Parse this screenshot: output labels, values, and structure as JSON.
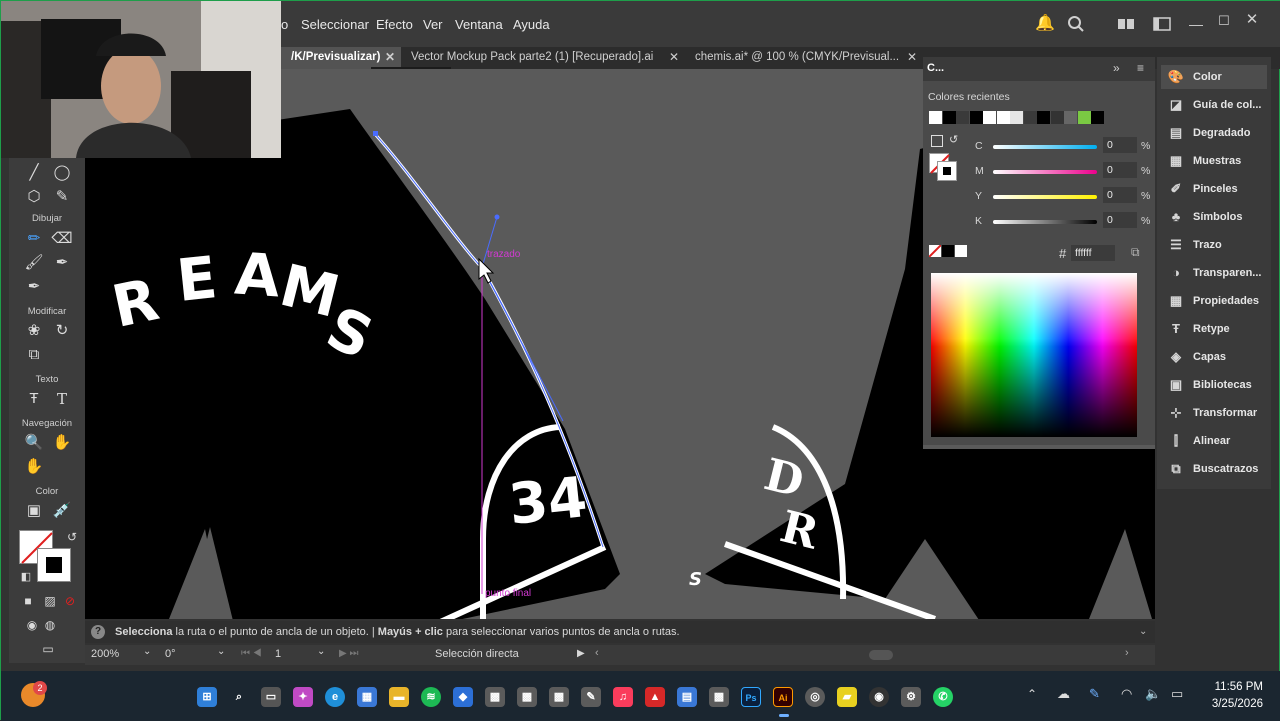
{
  "menu": {
    "items": [
      "o",
      "Seleccionar",
      "Efecto",
      "Ver",
      "Ventana",
      "Ayuda"
    ]
  },
  "tabs": [
    {
      "label": "/K/Previsualizar)",
      "active": true
    },
    {
      "label": "Vector Mockup Pack parte2  (1) [Recuperado].ai",
      "active": false
    },
    {
      "label": "chemis.ai* @ 100 % (CMYK/Previsual...",
      "active": false
    }
  ],
  "tools": {
    "group_draw": "Dibujar",
    "group_modify": "Modificar",
    "group_text": "Texto",
    "group_nav": "Navegación",
    "group_color": "Color"
  },
  "artwork": {
    "letters": [
      "R",
      "E",
      "A",
      "M",
      "S"
    ],
    "number": "34",
    "logo_top": "D",
    "logo_bottom": "R",
    "guide_label_1": "trazado",
    "guide_label_2": "punto final",
    "small_char": "S"
  },
  "color_panel": {
    "tab_label": "C...",
    "recent_label": "Colores recientes",
    "channels": [
      {
        "label": "C",
        "value": "0",
        "unit": "%"
      },
      {
        "label": "M",
        "value": "0",
        "unit": "%"
      },
      {
        "label": "Y",
        "value": "0",
        "unit": "%"
      },
      {
        "label": "K",
        "value": "0",
        "unit": "%"
      }
    ],
    "hex_prefix": "#",
    "hex_value": "ffffff",
    "recent_colors": [
      "#ffffff",
      "#000000",
      "#3a3a3a",
      "#000000",
      "#ffffff",
      "#ffffff",
      "#e6e6e6",
      "#3a3a3a",
      "#000000",
      "#333333",
      "#666666",
      "#7ac943",
      "#000000",
      "#4a4a4a"
    ]
  },
  "panels": [
    {
      "label": "Color",
      "icon": "palette-icon"
    },
    {
      "label": "Guía de col...",
      "icon": "color-guide-icon"
    },
    {
      "label": "Degradado",
      "icon": "gradient-icon"
    },
    {
      "label": "Muestras",
      "icon": "swatches-icon"
    },
    {
      "label": "Pinceles",
      "icon": "brushes-icon"
    },
    {
      "label": "Símbolos",
      "icon": "symbols-icon"
    },
    {
      "label": "Trazo",
      "icon": "stroke-icon"
    },
    {
      "label": "Transparen...",
      "icon": "transparency-icon"
    },
    {
      "label": "Propiedades",
      "icon": "properties-icon"
    },
    {
      "label": "Retype",
      "icon": "retype-icon"
    },
    {
      "label": "Capas",
      "icon": "layers-icon"
    },
    {
      "label": "Bibliotecas",
      "icon": "libraries-icon"
    },
    {
      "label": "Transformar",
      "icon": "transform-icon"
    },
    {
      "label": "Alinear",
      "icon": "align-icon"
    },
    {
      "label": "Buscatrazos",
      "icon": "pathfinder-icon"
    }
  ],
  "status": {
    "hint_bold_1": "Selecciona",
    "hint_1": " la ruta o el punto de ancla de un objeto.  |  ",
    "hint_bold_2": "Mayús + clic",
    "hint_2": " para seleccionar varios puntos de ancla o rutas."
  },
  "bottom": {
    "zoom": "200%",
    "rotation": "0°",
    "artboard": "1",
    "tool_name": "Selección directa"
  },
  "taskbar": {
    "time": "11:56 PM",
    "date": "3/25/2026",
    "notification_count": "2"
  }
}
